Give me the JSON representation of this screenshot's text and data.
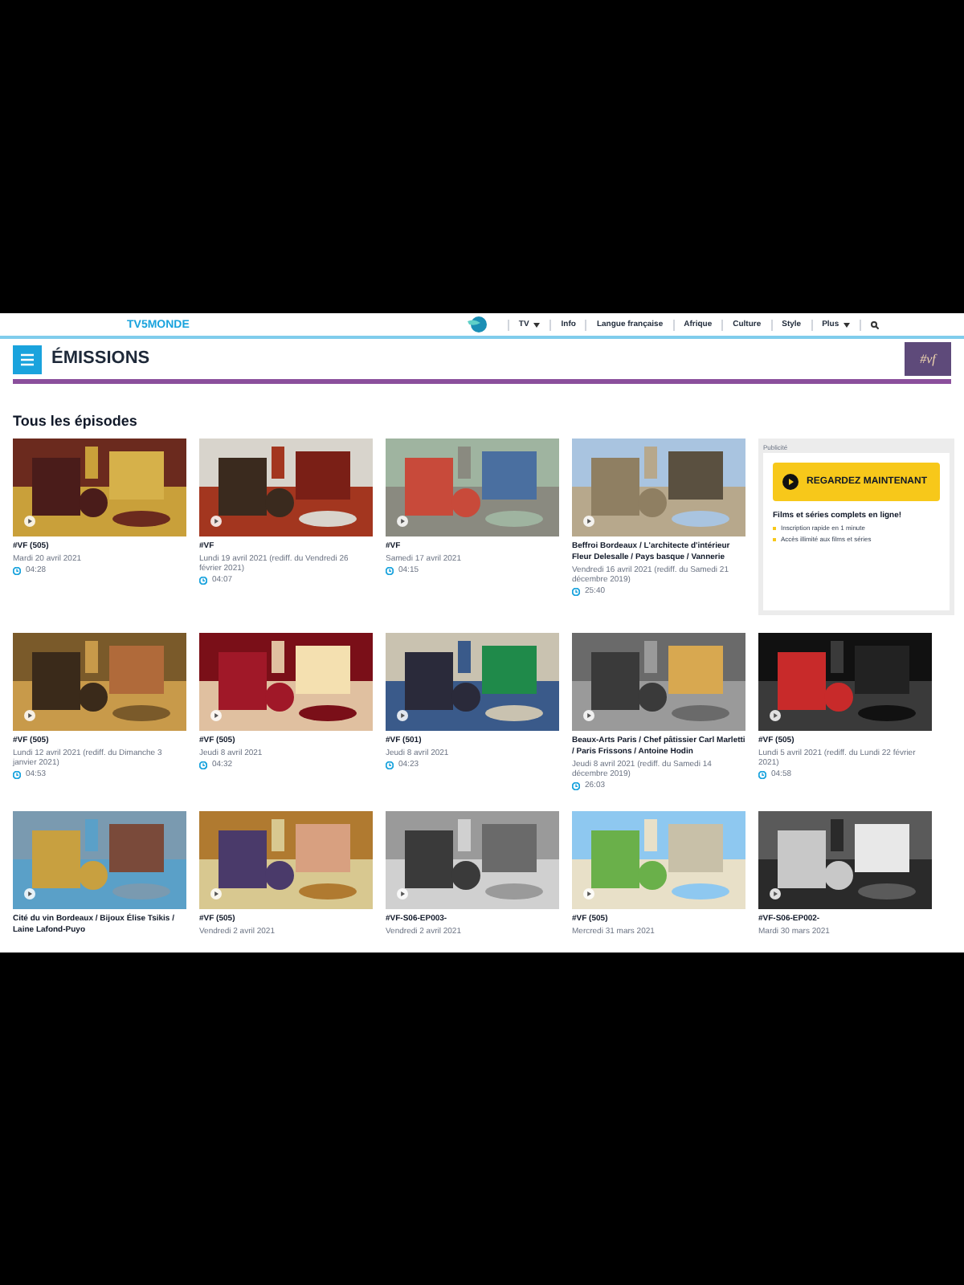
{
  "header": {
    "logo": "TV5MONDE",
    "nav": [
      {
        "label": "TV",
        "dropdown": true
      },
      {
        "label": "Info",
        "dropdown": false
      },
      {
        "label": "Langue française",
        "dropdown": false
      },
      {
        "label": "Afrique",
        "dropdown": false
      },
      {
        "label": "Culture",
        "dropdown": false
      },
      {
        "label": "Style",
        "dropdown": false
      },
      {
        "label": "Plus",
        "dropdown": true
      }
    ]
  },
  "section": {
    "title": "ÉMISSIONS",
    "badge": "#vf"
  },
  "heading": "Tous les épisodes",
  "rows": [
    {
      "items": [
        {
          "kind": "episode",
          "title": "#VF (505)",
          "date": "Mardi 20 avril 2021",
          "duration": "04:28"
        },
        {
          "kind": "episode",
          "title": "#VF",
          "date": "Lundi 19 avril 2021 (rediff. du Vendredi 26 février 2021)",
          "duration": "04:07"
        },
        {
          "kind": "episode",
          "title": "#VF",
          "date": "Samedi 17 avril 2021",
          "duration": "04:15"
        },
        {
          "kind": "episode",
          "title": "Beffroi Bordeaux / L'architecte d'intérieur Fleur Delesalle / Pays basque / Vannerie",
          "date": "Vendredi 16 avril 2021 (rediff. du Samedi 21 décembre 2019)",
          "duration": "25:40"
        },
        {
          "kind": "ad",
          "label": "Publicité",
          "button": "REGARDEZ MAINTENANT",
          "headline": "Films et séries complets en ligne!",
          "bullets": [
            "Inscription rapide en 1 minute",
            "Accès illimité aux films et séries"
          ]
        }
      ]
    },
    {
      "items": [
        {
          "kind": "episode",
          "title": "#VF (505)",
          "date": "Lundi 12 avril 2021 (rediff. du Dimanche 3 janvier 2021)",
          "duration": "04:53"
        },
        {
          "kind": "episode",
          "title": "#VF (505)",
          "date": "Jeudi 8 avril 2021",
          "duration": "04:32"
        },
        {
          "kind": "episode",
          "title": "#VF (501)",
          "date": "Jeudi 8 avril 2021",
          "duration": "04:23"
        },
        {
          "kind": "episode",
          "title": "Beaux-Arts Paris / Chef pâtissier Carl Marletti / Paris Frissons / Antoine Hodin",
          "date": "Jeudi 8 avril 2021 (rediff. du Samedi 14 décembre 2019)",
          "duration": "26:03"
        },
        {
          "kind": "episode",
          "title": "#VF (505)",
          "date": "Lundi 5 avril 2021 (rediff. du Lundi 22 février 2021)",
          "duration": "04:58"
        }
      ]
    },
    {
      "items": [
        {
          "kind": "episode",
          "title": "Cité du vin Bordeaux / Bijoux Élise Tsikis / Laine Lafond-Puyo"
        },
        {
          "kind": "episode",
          "title": "#VF (505)",
          "date": "Vendredi 2 avril 2021"
        },
        {
          "kind": "episode",
          "title": "#VF-S06-EP003-",
          "date": "Vendredi 2 avril 2021"
        },
        {
          "kind": "episode",
          "title": "#VF (505)",
          "date": "Mercredi 31 mars 2021"
        },
        {
          "kind": "episode",
          "title": "#VF-S06-EP002-",
          "date": "Mardi 30 mars 2021"
        }
      ]
    }
  ]
}
